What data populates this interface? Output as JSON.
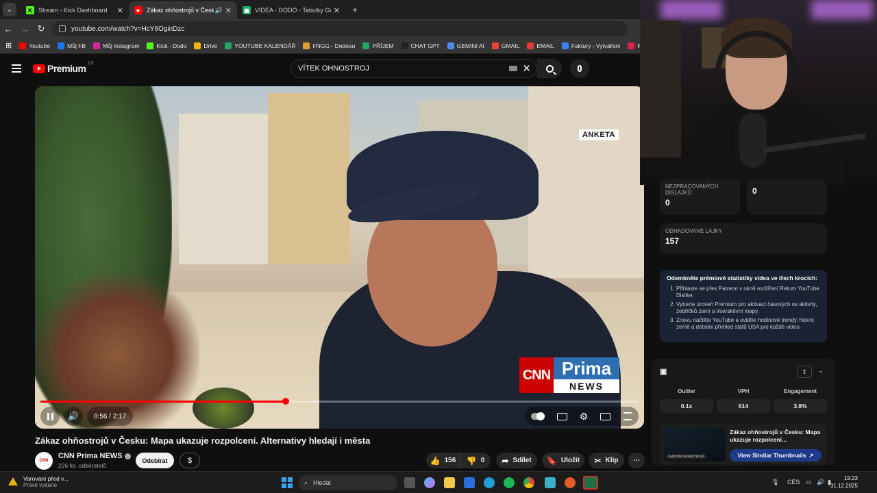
{
  "browser": {
    "tabs": [
      {
        "title": "Stream - Kick Dashboard",
        "favicon_color": "#53fc18",
        "favicon_letter": "K"
      },
      {
        "title": "Zákaz ohňostrojů v Česku: M",
        "favicon_color": "#ff0000",
        "favicon_letter": "▶",
        "audio": "🔊"
      },
      {
        "title": "VIDEA - DODO - Tabulky Goog",
        "favicon_color": "#23a566",
        "favicon_letter": "▦"
      }
    ],
    "close_glyph": "✕",
    "new_tab_glyph": "+",
    "url": "youtube.com/watch?v=HcY6OginDzc",
    "bookmarks": [
      {
        "label": "Youtube",
        "color": "#ff0000"
      },
      {
        "label": "Můj FB",
        "color": "#1877f2"
      },
      {
        "label": "Můj instagram",
        "color": "#d6249f"
      },
      {
        "label": "Kick - Dodo",
        "color": "#53fc18"
      },
      {
        "label": "Drive",
        "color": "#f4b400"
      },
      {
        "label": "YOUTUBE KALENDÁŘ",
        "color": "#23a566"
      },
      {
        "label": "FNGG - Dodoeu",
        "color": "#e0a030"
      },
      {
        "label": "PŘÍJEM",
        "color": "#23a566"
      },
      {
        "label": "CHAT GPT",
        "color": "#222222"
      },
      {
        "label": "GEMINI AI",
        "color": "#4f8cf7"
      },
      {
        "label": "GMAIL",
        "color": "#ea4335"
      },
      {
        "label": "EMAIL",
        "color": "#e53935"
      },
      {
        "label": "Faktury - Vytváření",
        "color": "#3b82f6"
      },
      {
        "label": "PNG",
        "color": "#e11d48"
      }
    ]
  },
  "youtube": {
    "logo_text": "Premium",
    "logo_region": "CZ",
    "search_value": "VÍTEK OHNOSTROJ",
    "clear_glyph": "✕",
    "video": {
      "overlay_label": "ANKETA",
      "logo_cnn": "CNN",
      "logo_prima": "Prima",
      "logo_news": "NEWS",
      "time": "0:56 / 2:17",
      "progress": 0.41,
      "volume_glyph": "🔊"
    },
    "title": "Zákaz ohňostrojů v Česku: Mapa ukazuje rozpolcení. Alternativy hledají i města",
    "channel": {
      "name": "CNN Prima NEWS",
      "subscribers": "226 tis. odběratelů",
      "avatar_text": "CNN"
    },
    "subscribe_label": "Odebírat",
    "dollar_glyph": "$",
    "likes": "156",
    "dislikes": "0",
    "share_label": "Sdílet",
    "save_label": "Uložit",
    "clip_label": "Klip",
    "more_glyph": "⋯"
  },
  "side_panel": {
    "stats": [
      {
        "label": "NEZPRACOVANÝCH DISLAJKŮ",
        "value": "0"
      },
      {
        "label": "",
        "value": "0"
      },
      {
        "label": "ODHADOVANÉ LAJKY",
        "value": "157"
      }
    ],
    "promo": {
      "heading": "Odemkněte prémiové statistiky videa ve třech krocích:",
      "steps": [
        "Přihlaste se přes Patreon v okně rozšíření Return YouTube Dislike.",
        "Vyberte úroveň Premium pro aktivaci časových os aktivity, žebříčků zemí a interaktivní mapy.",
        "Znovu načtěte YouTube a uvidíte hodinové trendy, hlavní země a detailní přehled států USA pro každé video."
      ]
    },
    "metrics": [
      {
        "label": "Outlier",
        "value": "0.1x"
      },
      {
        "label": "VPH",
        "value": "614"
      },
      {
        "label": "Engagement",
        "value": "3.8%"
      }
    ],
    "related": {
      "title": "Zákaz ohňostrojů v Česku: Mapa ukazuje rozpolcení...",
      "button": "View Similar Thumbnails",
      "thumb_caption": "OMEZENÍ OHŇOSTROJŮ"
    }
  },
  "taskbar": {
    "notification_title": "Varování před v...",
    "notification_sub": "Právě vydáno",
    "search_placeholder": "Hledat",
    "language": "CES",
    "time": "19:23",
    "date": "31.12.2025"
  }
}
